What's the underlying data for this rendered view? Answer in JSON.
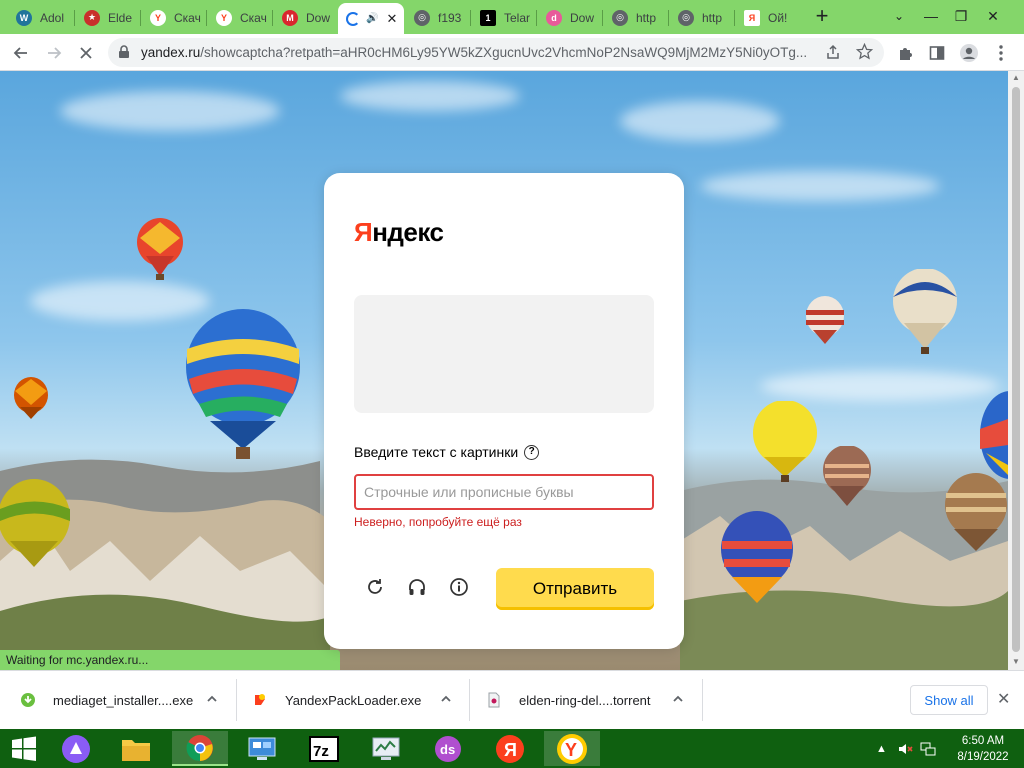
{
  "tabs": [
    {
      "label": "Adol",
      "icon": "wordpress-icon"
    },
    {
      "label": "Elde",
      "icon": "star-emblem-icon"
    },
    {
      "label": "Скач",
      "icon": "yandex-y-icon"
    },
    {
      "label": "Скач",
      "icon": "yandex-y-icon"
    },
    {
      "label": "Dow",
      "icon": "mega-icon"
    },
    {
      "label": "",
      "icon": "loading-icon",
      "active": true
    },
    {
      "label": "f193",
      "icon": "globe-icon"
    },
    {
      "label": "Telar",
      "icon": "telegram-icon"
    },
    {
      "label": "Dow",
      "icon": "download-site-icon"
    },
    {
      "label": "http",
      "icon": "globe-icon"
    },
    {
      "label": "http",
      "icon": "globe-icon"
    },
    {
      "label": "Ой!",
      "icon": "yandex-ya-icon"
    }
  ],
  "window_controls": {
    "minimize": "—",
    "maximize": "❐",
    "close": "✕"
  },
  "address": {
    "host": "yandex.ru",
    "path": "/showcaptcha?retpath=aHR0cHM6Ly95YW5kZXgucnUvc2VhcmNoP2NsaWQ9MjM2MzY5Ni0yOTg..."
  },
  "status": "Waiting for mc.yandex.ru...",
  "captcha": {
    "logo_first": "Я",
    "logo_rest": "ндекс",
    "prompt": "Введите текст с картинки",
    "help": "?",
    "placeholder": "Строчные или прописные буквы",
    "error": "Неверно, попробуйте ещё раз",
    "submit": "Отправить"
  },
  "downloads": [
    {
      "name": "mediaget_installer....exe",
      "icon": "mediaget-icon"
    },
    {
      "name": "YandexPackLoader.exe",
      "icon": "yandex-pack-icon"
    },
    {
      "name": "elden-ring-del....torrent",
      "icon": "torrent-file-icon"
    }
  ],
  "shelf": {
    "show_all": "Show all",
    "close": "✕"
  },
  "taskbar": {
    "time": "6:50 AM",
    "date": "8/19/2022",
    "apps": [
      "windows-start-icon",
      "alice-icon",
      "file-explorer-icon",
      "chrome-icon",
      "control-panel-icon",
      "7zip-icon",
      "system-monitor-icon",
      "ds-app-icon",
      "yandex-ya-icon",
      "yandex-browser-icon"
    ]
  },
  "colors": {
    "tab_strip": "#84d66a",
    "taskbar": "#0f6010",
    "accent_yandex": "#fc3f1d",
    "submit": "#ffdb4d",
    "error": "#cc1f1f"
  }
}
